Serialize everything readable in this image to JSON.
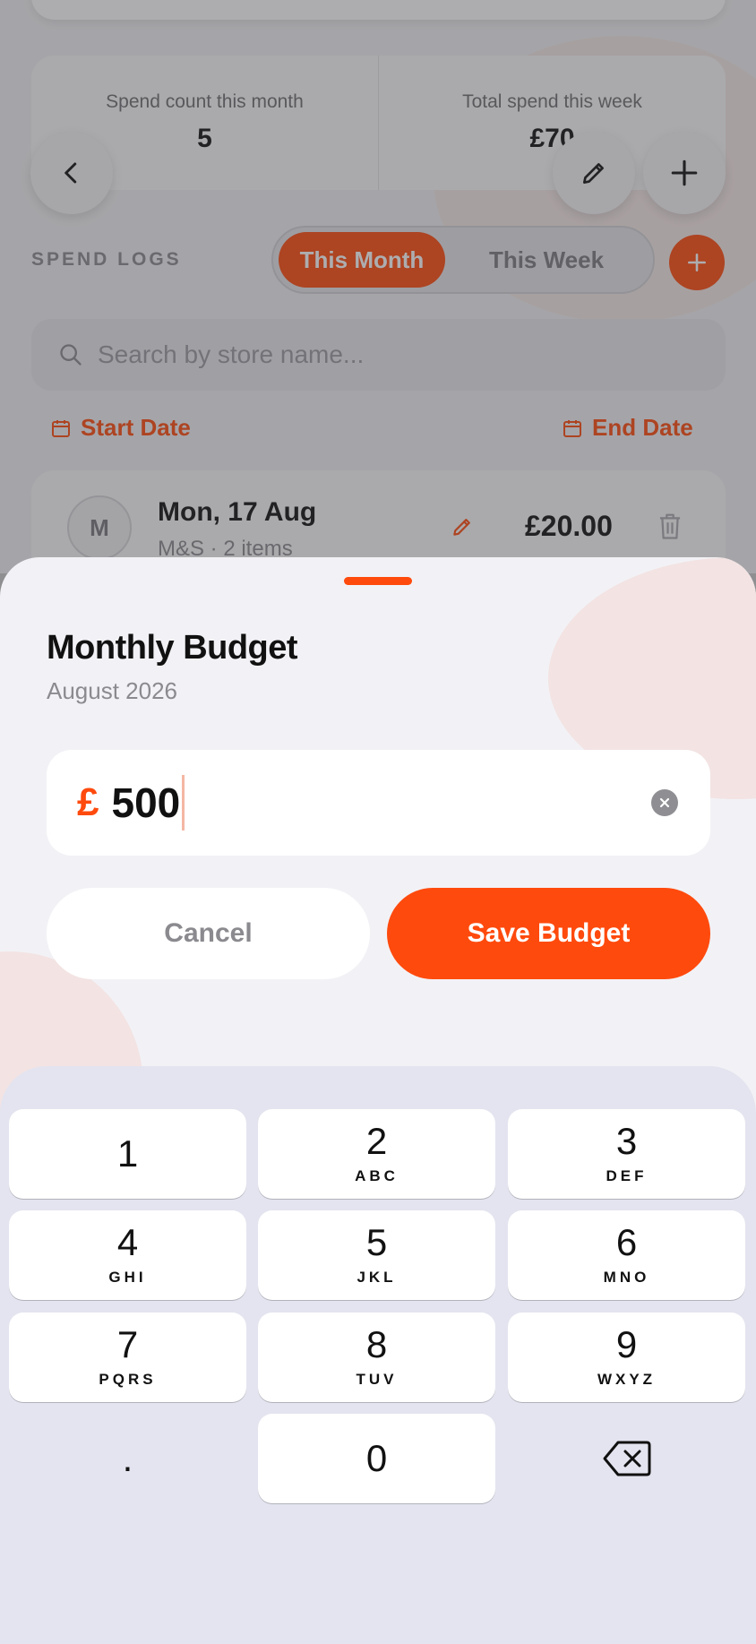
{
  "background": {
    "stats": [
      {
        "label": "Spend count this month",
        "value": "5"
      },
      {
        "label": "Total spend this week",
        "value": "£70"
      }
    ],
    "section_title": "SPEND LOGS",
    "segments": {
      "active": "This Month",
      "inactive": "This Week"
    },
    "search": {
      "placeholder": "Search by store name..."
    },
    "start_date_label": "Start Date",
    "end_date_label": "End Date",
    "log": {
      "avatar_letter": "M",
      "date": "Mon, 17 Aug",
      "store": "M&S · 2 items",
      "amount": "£20.00"
    }
  },
  "sheet": {
    "title": "Monthly Budget",
    "subtitle": "August 2026",
    "currency_symbol": "£",
    "amount": "500",
    "cancel_label": "Cancel",
    "save_label": "Save Budget"
  },
  "keypad": {
    "keys": [
      {
        "num": "1",
        "letters": ""
      },
      {
        "num": "2",
        "letters": "ABC"
      },
      {
        "num": "3",
        "letters": "DEF"
      },
      {
        "num": "4",
        "letters": "GHI"
      },
      {
        "num": "5",
        "letters": "JKL"
      },
      {
        "num": "6",
        "letters": "MNO"
      },
      {
        "num": "7",
        "letters": "PQRS"
      },
      {
        "num": "8",
        "letters": "TUV"
      },
      {
        "num": "9",
        "letters": "WXYZ"
      },
      {
        "num": ".",
        "letters": ""
      },
      {
        "num": "0",
        "letters": ""
      }
    ]
  },
  "colors": {
    "accent": "#ff4a0d",
    "sheet_bg": "#f2f2f6",
    "keypad_bg": "#e3e4ef"
  },
  "icons": [
    "chevron-left-icon",
    "pencil-icon",
    "plus-icon",
    "search-icon",
    "calendar-icon",
    "trash-icon",
    "clear-icon",
    "backspace-icon"
  ]
}
